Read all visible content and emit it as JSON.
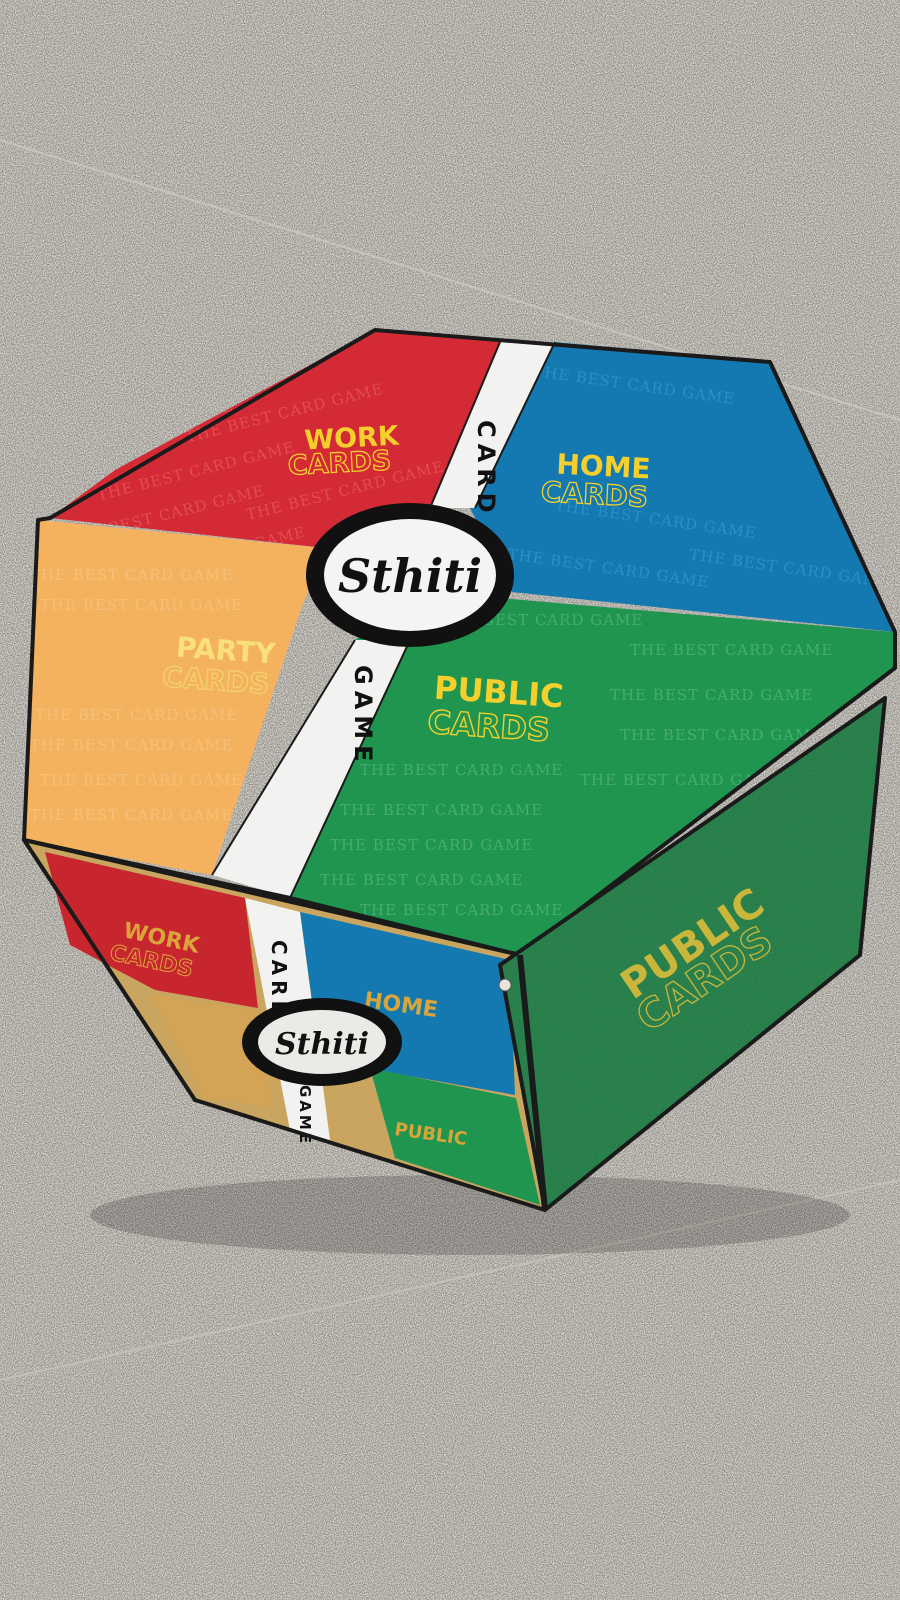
{
  "brand": {
    "logo": "Sthiti",
    "band_top": "CARD",
    "band_bottom": "GAME"
  },
  "pattern_text": "THE BEST CARD GAME",
  "quadrants": {
    "work": {
      "line1": "WORK",
      "line2": "CARDS"
    },
    "home": {
      "line1": "HOME",
      "line2": "CARDS"
    },
    "party": {
      "line1": "PARTY",
      "line2": "CARDS"
    },
    "public": {
      "line1": "PUBLIC",
      "line2": "CARDS"
    }
  },
  "side_faces": {
    "front": {
      "work": "WORK",
      "cards": "CARDS",
      "home": "HOME",
      "public": "PUBLIC",
      "band_top": "CARD",
      "band_bottom": "GAME",
      "logo": "Sthiti"
    },
    "right": {
      "line1": "PUBLIC",
      "line2": "CARDS"
    }
  },
  "colors": {
    "floor": "#d9d6cf",
    "red": "#d42a35",
    "blue": "#1479b0",
    "orange": "#f4b25f",
    "green": "#1f9550",
    "green_dark": "#1c7f45",
    "yellow_text": "#f5d02d",
    "band": "#f2f2f0",
    "edge": "#1a1a1a"
  }
}
